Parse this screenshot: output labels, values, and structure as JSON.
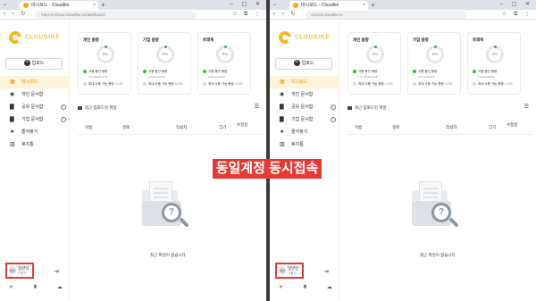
{
  "browser": {
    "tab_title": "대시보드 - Cloudike",
    "tab_close": "×",
    "new_tab": "+",
    "tab_menu": "⌄",
    "window_controls": "– ▢ ✕",
    "nav_buttons": "‹ › ↻",
    "right_icons": "☆ ⧉ ⋮",
    "left_url": "https://vcloud.cloudike.io/dashboard",
    "right_url": "vcloud.cloudike.io"
  },
  "sidebar": {
    "logo_text": "CLOUDIKE",
    "upload_label": "업로드",
    "upload_icon": "+",
    "items": [
      {
        "label": "대시보드",
        "icon": "▦",
        "info": ""
      },
      {
        "label": "개인 문서함",
        "icon": "◉",
        "info": ""
      },
      {
        "label": "공유 문서함",
        "icon": "▇",
        "info": "i"
      },
      {
        "label": "기업 문서함",
        "icon": "▇",
        "info": "i"
      },
      {
        "label": "즐겨찾기",
        "icon": "★",
        "info": ""
      },
      {
        "label": "휴지통",
        "icon": "▥",
        "info": ""
      }
    ],
    "user": {
      "avatar_text": "일반",
      "name": "일반인",
      "role": "사용자"
    },
    "logout_icon": "⇥",
    "bottom_icons": "✕ ♜ ☁ ⚙"
  },
  "cards": [
    {
      "title": "개인 용량",
      "percent": "0%",
      "used_label": "사용 중인 용량",
      "used_value": "176.98KB/10GB",
      "max_label": "최대 사용 가능 용량",
      "max_value": "10GB"
    },
    {
      "title": "기업 용량",
      "percent": "0%",
      "used_label": "사용 중인 용량",
      "used_value": "0 Bytes/10GB",
      "max_label": "최대 사용 가능 용량",
      "max_value": "10GB"
    },
    {
      "title": "트래픽",
      "percent": "0%",
      "used_label": "사용 중인 용량",
      "used_value": "0 Bytes/10GB",
      "max_label": "최대 사용 가능 용량",
      "max_value": "10GB"
    }
  ],
  "files": {
    "section_title": "최근 업로드된 파일",
    "view_icon": "☰",
    "columns": [
      "이름",
      "경로",
      "작성자",
      "크기",
      "수정일"
    ],
    "empty_icon": "?",
    "empty_text": "최근 파일이 없습니다."
  },
  "banner": "동일계정 동시접속",
  "colors": {
    "accent": "#f5b921",
    "active_bg": "#fff4da",
    "ring": "#4caf50",
    "banner": "#e53935"
  }
}
